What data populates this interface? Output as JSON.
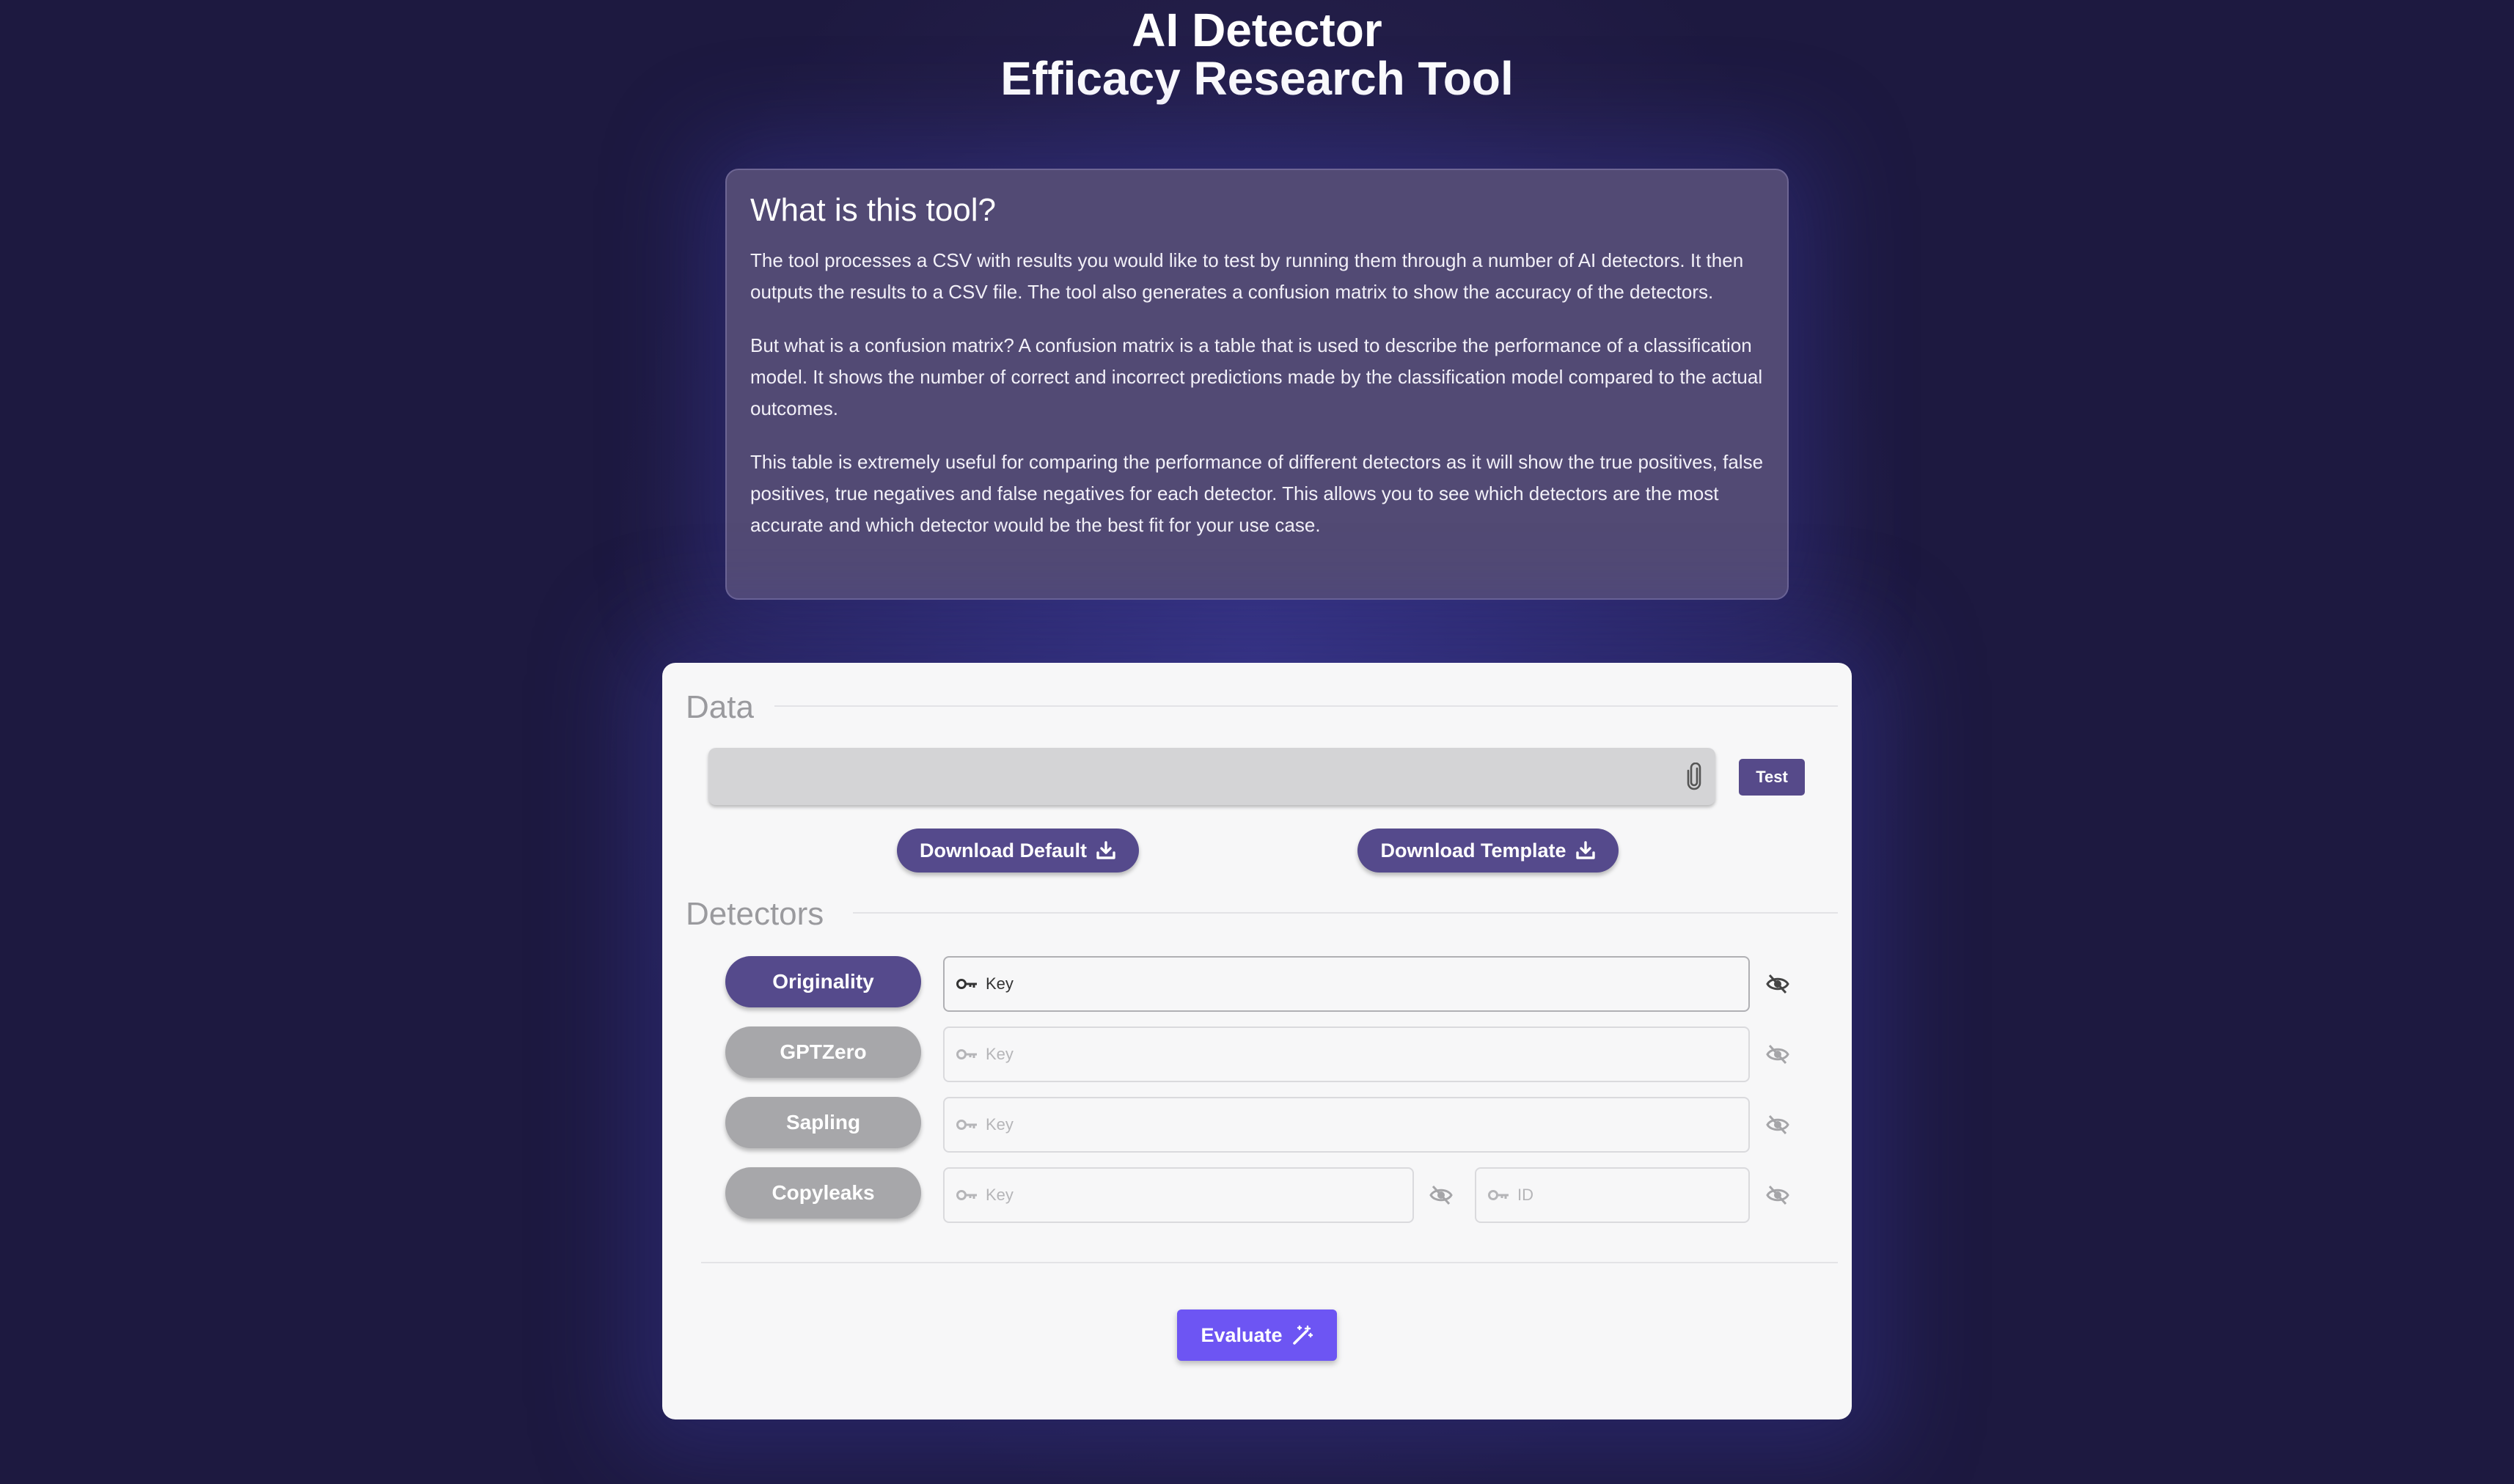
{
  "header": {
    "title_line1": "AI Detector",
    "title_line2": "Efficacy Research Tool"
  },
  "info": {
    "heading": "What is this tool?",
    "paragraphs": [
      "The tool processes a CSV with results you would like to test by running them through a number of AI detectors. It then outputs the results to a CSV file. The tool also generates a confusion matrix to show the accuracy of the detectors.",
      "But what is a confusion matrix? A confusion matrix is a table that is used to describe the performance of a classification model. It shows the number of correct and incorrect predictions made by the classification model compared to the actual outcomes.",
      "This table is extremely useful for comparing the performance of different detectors as it will show the true positives, false positives, true negatives and false negatives for each detector. This allows you to see which detectors are the most accurate and which detector would be the best fit for your use case."
    ]
  },
  "data_section": {
    "title": "Data",
    "file_value": "",
    "test_label": "Test",
    "download_default_label": "Download Default",
    "download_template_label": "Download Template"
  },
  "detectors_section": {
    "title": "Detectors",
    "detectors": [
      {
        "name": "Originality",
        "active": true,
        "key_placeholder": "Key"
      },
      {
        "name": "GPTZero",
        "active": false,
        "key_placeholder": "Key"
      },
      {
        "name": "Sapling",
        "active": false,
        "key_placeholder": "Key"
      },
      {
        "name": "Copyleaks",
        "active": false,
        "key_placeholder": "Key",
        "id_placeholder": "ID"
      }
    ]
  },
  "evaluate_label": "Evaluate",
  "colors": {
    "primary": "#554a8c",
    "evaluate": "#6d55f3",
    "inactive": "#a7a7aa",
    "background": "#221d47"
  },
  "icons": {
    "attach": "paperclip-icon",
    "download": "download-icon",
    "key": "key-icon",
    "visibility": "eye-off-icon",
    "evaluate": "magic-wand-icon"
  }
}
